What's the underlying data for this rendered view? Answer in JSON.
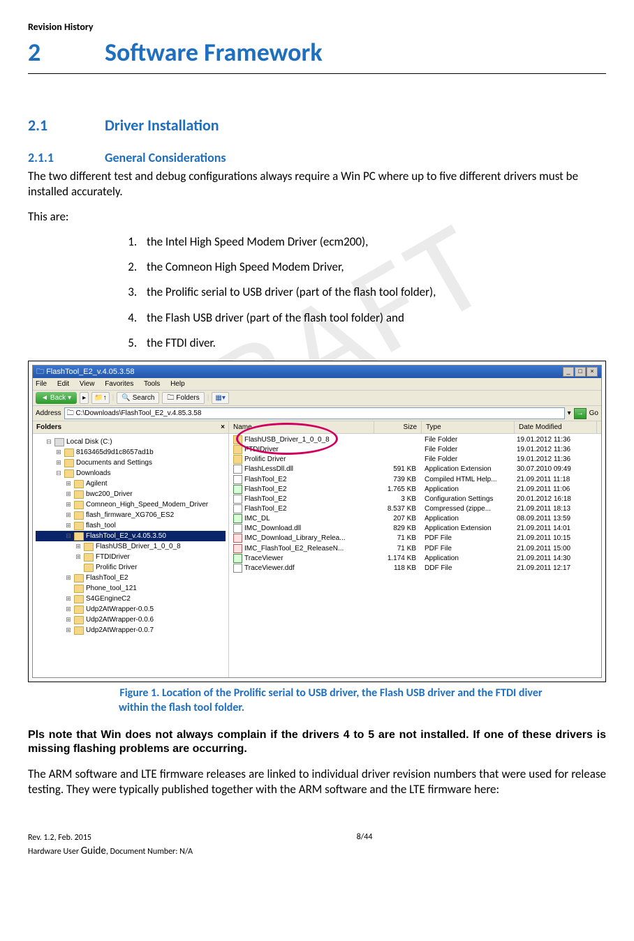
{
  "header": "Revision History",
  "watermark": "DRAFT",
  "h1": {
    "num": "2",
    "title": "Software Framework"
  },
  "h2": {
    "num": "2.1",
    "title": "Driver Installation"
  },
  "h3": {
    "num": "2.1.1",
    "title": "General Considerations"
  },
  "p1": "The two different test and debug configurations always require a Win PC where up to five different drivers must be installed accurately.",
  "p2": "This are:",
  "list": [
    "the Intel High Speed Modem Driver (ecm200),",
    "the Comneon High Speed Modem Driver,",
    "the Prolific serial to USB driver (part of the flash tool folder),",
    "the Flash USB driver (part of the flash tool folder) and",
    "the FTDI diver."
  ],
  "win": {
    "title": "FlashTool_E2_v.4.05.3.58",
    "menu": [
      "File",
      "Edit",
      "View",
      "Favorites",
      "Tools",
      "Help"
    ],
    "back": "Back",
    "search": "Search",
    "foldersBtn": "Folders",
    "addrLabel": "Address",
    "addrPath": "C:\\Downloads\\FlashTool_E2_v.4.85.3.58",
    "go": "Go",
    "foldersHeader": "Folders",
    "tree": [
      {
        "i": 1,
        "exp": "−",
        "icon": "disk",
        "label": "Local Disk (C:)"
      },
      {
        "i": 2,
        "exp": "+",
        "icon": "folder",
        "label": "8163465d9d1c8657ad1b"
      },
      {
        "i": 2,
        "exp": "+",
        "icon": "folder",
        "label": "Documents and Settings"
      },
      {
        "i": 2,
        "exp": "−",
        "icon": "folder",
        "label": "Downloads"
      },
      {
        "i": 3,
        "exp": "+",
        "icon": "folder",
        "label": "Agilent"
      },
      {
        "i": 3,
        "exp": "+",
        "icon": "folder",
        "label": "bwc200_Driver"
      },
      {
        "i": 3,
        "exp": "+",
        "icon": "folder",
        "label": "Comneon_High_Speed_Modem_Driver"
      },
      {
        "i": 3,
        "exp": "+",
        "icon": "folder",
        "label": "flash_firmware_XG706_ES2"
      },
      {
        "i": 3,
        "exp": "+",
        "icon": "folder",
        "label": "flash_tool"
      },
      {
        "i": 3,
        "exp": "−",
        "icon": "folder",
        "label": "FlashTool_E2_v.4.05.3.50",
        "sel": true
      },
      {
        "i": 4,
        "exp": "+",
        "icon": "folder",
        "label": "FlashUSB_Driver_1_0_0_8"
      },
      {
        "i": 4,
        "exp": "+",
        "icon": "folder",
        "label": "FTDIDriver"
      },
      {
        "i": 4,
        "exp": " ",
        "icon": "folder",
        "label": "Prolific Driver"
      },
      {
        "i": 3,
        "exp": "+",
        "icon": "folder",
        "label": "FlashTool_E2"
      },
      {
        "i": 3,
        "exp": " ",
        "icon": "folder",
        "label": "Phone_tool_121"
      },
      {
        "i": 3,
        "exp": "+",
        "icon": "folder",
        "label": "S4GEngineC2"
      },
      {
        "i": 3,
        "exp": "+",
        "icon": "folder",
        "label": "Udp2AtWrapper-0.0.5"
      },
      {
        "i": 3,
        "exp": "+",
        "icon": "folder",
        "label": "Udp2AtWrapper-0.0.6"
      },
      {
        "i": 3,
        "exp": "+",
        "icon": "folder",
        "label": "Udp2AtWrapper-0.0.7"
      }
    ],
    "columns": {
      "name": "Name",
      "size": "Size",
      "type": "Type",
      "date": "Date Modified"
    },
    "files": [
      {
        "icon": "folder",
        "name": "FlashUSB_Driver_1_0_0_8",
        "size": "",
        "type": "File Folder",
        "date": "19.01.2012 11:36"
      },
      {
        "icon": "folder",
        "name": "FTDIDriver",
        "size": "",
        "type": "File Folder",
        "date": "19.01.2012 11:36"
      },
      {
        "icon": "folder",
        "name": "Prolific Driver",
        "size": "",
        "type": "File Folder",
        "date": "19.01.2012 11:36"
      },
      {
        "icon": "generic",
        "name": "FlashLessDll.dll",
        "size": "591 KB",
        "type": "Application Extension",
        "date": "30.07.2010 09:49"
      },
      {
        "icon": "generic",
        "name": "FlashTool_E2",
        "size": "739 KB",
        "type": "Compiled HTML Help...",
        "date": "21.09.2011 11:18"
      },
      {
        "icon": "app",
        "name": "FlashTool_E2",
        "size": "1.765 KB",
        "type": "Application",
        "date": "21.09.2011 11:06"
      },
      {
        "icon": "generic",
        "name": "FlashTool_E2",
        "size": "3 KB",
        "type": "Configuration Settings",
        "date": "20.01.2012 16:18"
      },
      {
        "icon": "generic",
        "name": "FlashTool_E2",
        "size": "8.537 KB",
        "type": "Compressed (zippe...",
        "date": "21.09.2011 18:13"
      },
      {
        "icon": "app",
        "name": "IMC_DL",
        "size": "207 KB",
        "type": "Application",
        "date": "08.09.2011 13:59"
      },
      {
        "icon": "generic",
        "name": "IMC_Download.dll",
        "size": "829 KB",
        "type": "Application Extension",
        "date": "21.09.2011 14:01"
      },
      {
        "icon": "pdf",
        "name": "IMC_Download_Library_Relea...",
        "size": "71 KB",
        "type": "PDF File",
        "date": "21.09.2011 10:15"
      },
      {
        "icon": "pdf",
        "name": "IMC_FlashTool_E2_ReleaseN...",
        "size": "71 KB",
        "type": "PDF File",
        "date": "21.09.2011 15:00"
      },
      {
        "icon": "app",
        "name": "TraceViewer",
        "size": "1.174 KB",
        "type": "Application",
        "date": "21.09.2011 14:30"
      },
      {
        "icon": "generic",
        "name": "TraceViewer.ddf",
        "size": "118 KB",
        "type": "DDF File",
        "date": "21.09.2011 12:17"
      }
    ]
  },
  "figCaption1": "Figure 1. Location of the Prolific serial to USB driver, the Flash USB driver and the FTDI diver",
  "figCaption2": "within the flash tool folder.",
  "note": "Pls note that Win does not always complain if the drivers 4 to 5 are not installed. If one of these drivers is missing flashing problems are occurring.",
  "p3": "The ARM software and LTE firmware releases are linked to individual driver revision numbers that were used for release testing. They were typically published together with the ARM software and the LTE firmware here:",
  "footer": {
    "rev": "Rev. 1.2, Feb. 2015",
    "guide1": "Hardware User ",
    "guide2": "Guide",
    "guide3": ", Document Number: N/A",
    "page": "8/44"
  }
}
